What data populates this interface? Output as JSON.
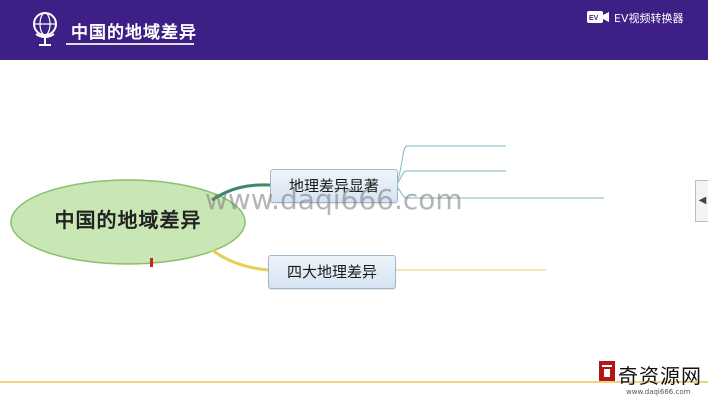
{
  "header": {
    "title": "中国的地域差异",
    "app_label": "EV视频转换器",
    "background_color": "#3d1f86"
  },
  "mindmap": {
    "central_topic": "中国的地域差异",
    "branches": [
      {
        "label": "地理差异显著"
      },
      {
        "label": "四大地理差异"
      }
    ]
  },
  "watermark": {
    "text": "www.daqi666.com"
  },
  "corner_badge": {
    "name": "奇资源网",
    "url": "www.daqi666.com"
  },
  "icons": {
    "header_logo": "globe-icon",
    "app_logo": "ev-logo-icon",
    "side_handle": "chevron-left-icon"
  },
  "colors": {
    "central_fill": "#c8e6b6",
    "branch_fill": "#dce8f5",
    "accent_green": "#3a8a6a",
    "accent_yellow": "#e4cf57"
  }
}
